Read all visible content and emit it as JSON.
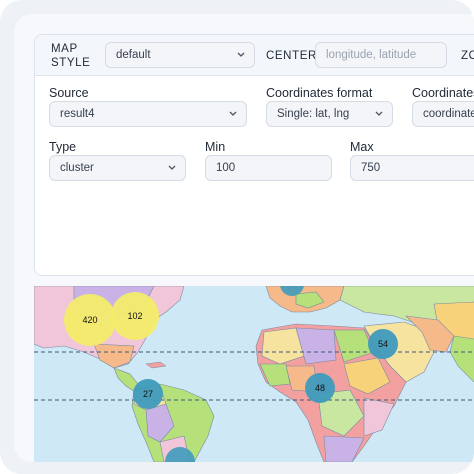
{
  "topbar": {
    "map_style_label": "MAP\nSTYLE",
    "map_style_value": "default",
    "center_label": "CENTER",
    "center_placeholder": "longitude, latitude",
    "zoom_label_partial": "ZO"
  },
  "form": {
    "source_label": "Source",
    "source_value": "result4",
    "coord_format_label": "Coordinates format",
    "coord_format_value": "Single: lat, lng",
    "coordinates_label": "Coordinates",
    "coordinates_value": "coordinate",
    "type_label": "Type",
    "type_value": "cluster",
    "min_label": "Min",
    "min_value": "100",
    "max_label": "Max",
    "max_value": "750"
  },
  "map": {
    "clusters": [
      {
        "label": "420",
        "color": "#f3ec6a"
      },
      {
        "label": "102",
        "color": "#f3ec6a"
      },
      {
        "label": "27",
        "color": "#3f9bbd"
      },
      {
        "label": "48",
        "color": "#3f9bbd"
      },
      {
        "label": "54",
        "color": "#3f9bbd"
      }
    ]
  },
  "colors": {
    "water": "#cfe8f5",
    "cluster_small": "#3f9bbd",
    "cluster_large": "#f3ec6a"
  }
}
